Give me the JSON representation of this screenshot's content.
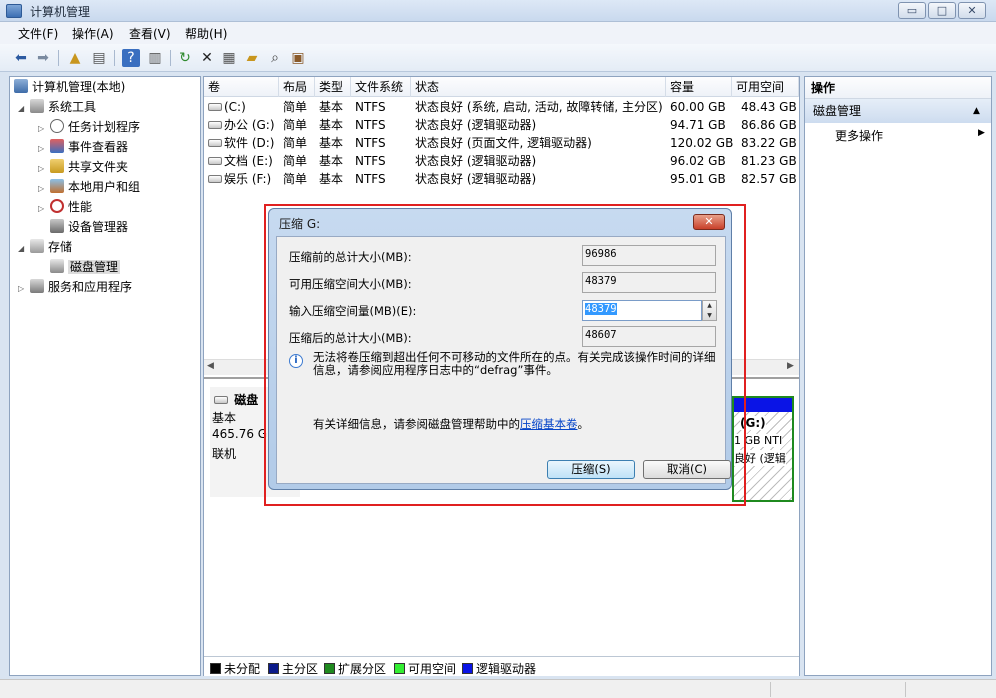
{
  "window": {
    "title": "计算机管理"
  },
  "menu": [
    "文件(F)",
    "操作(A)",
    "查看(V)",
    "帮助(H)"
  ],
  "tree": {
    "root": "计算机管理(本地)",
    "system_tools": "系统工具",
    "task_scheduler": "任务计划程序",
    "event_viewer": "事件查看器",
    "shared_folders": "共享文件夹",
    "local_users": "本地用户和组",
    "performance": "性能",
    "device_manager": "设备管理器",
    "storage": "存储",
    "disk_management": "磁盘管理",
    "services": "服务和应用程序"
  },
  "volumes": {
    "headers": [
      "卷",
      "布局",
      "类型",
      "文件系统",
      "状态",
      "容量",
      "可用空间"
    ],
    "rows": [
      [
        "(C:)",
        "简单",
        "基本",
        "NTFS",
        "状态良好 (系统, 启动, 活动, 故障转储, 主分区)",
        "60.00 GB",
        "48.43 GB"
      ],
      [
        "办公 (G:)",
        "简单",
        "基本",
        "NTFS",
        "状态良好 (逻辑驱动器)",
        "94.71 GB",
        "86.86 GB"
      ],
      [
        "软件 (D:)",
        "简单",
        "基本",
        "NTFS",
        "状态良好 (页面文件, 逻辑驱动器)",
        "120.02 GB",
        "83.22 GB"
      ],
      [
        "文档 (E:)",
        "简单",
        "基本",
        "NTFS",
        "状态良好 (逻辑驱动器)",
        "96.02 GB",
        "81.23 GB"
      ],
      [
        "娱乐 (F:)",
        "简单",
        "基本",
        "NTFS",
        "状态良好 (逻辑驱动器)",
        "95.01 GB",
        "82.57 GB"
      ]
    ]
  },
  "disk": {
    "label": "磁盘",
    "type": "基本",
    "size": "465.76 G",
    "status": "联机",
    "g_name": "(G:)",
    "g_size": "1 GB NTI",
    "g_status": "良好 (逻辑"
  },
  "legend": [
    "未分配",
    "主分区",
    "扩展分区",
    "可用空间",
    "逻辑驱动器"
  ],
  "legend_colors": [
    "#000000",
    "#0a1a8a",
    "#1f8a1f",
    "#33ee33",
    "#0a14e6"
  ],
  "actions": {
    "header": "操作",
    "group": "磁盘管理",
    "more": "更多操作"
  },
  "dialog": {
    "title": "压缩 G:",
    "total_before_label": "压缩前的总计大小(MB):",
    "total_before_value": "96986",
    "available_label": "可用压缩空间大小(MB):",
    "available_value": "48379",
    "input_label": "输入压缩空间量(MB)(E):",
    "input_value": "48379",
    "total_after_label": "压缩后的总计大小(MB):",
    "total_after_value": "48607",
    "info": "无法将卷压缩到超出任何不可移动的文件所在的点。有关完成该操作时间的详细信息，请参阅应用程序日志中的“defrag”事件。",
    "help_prefix": "有关详细信息，请参阅磁盘管理帮助中的",
    "help_link": "压缩基本卷",
    "help_suffix": "。",
    "shrink_button": "压缩(S)",
    "cancel_button": "取消(C)"
  }
}
